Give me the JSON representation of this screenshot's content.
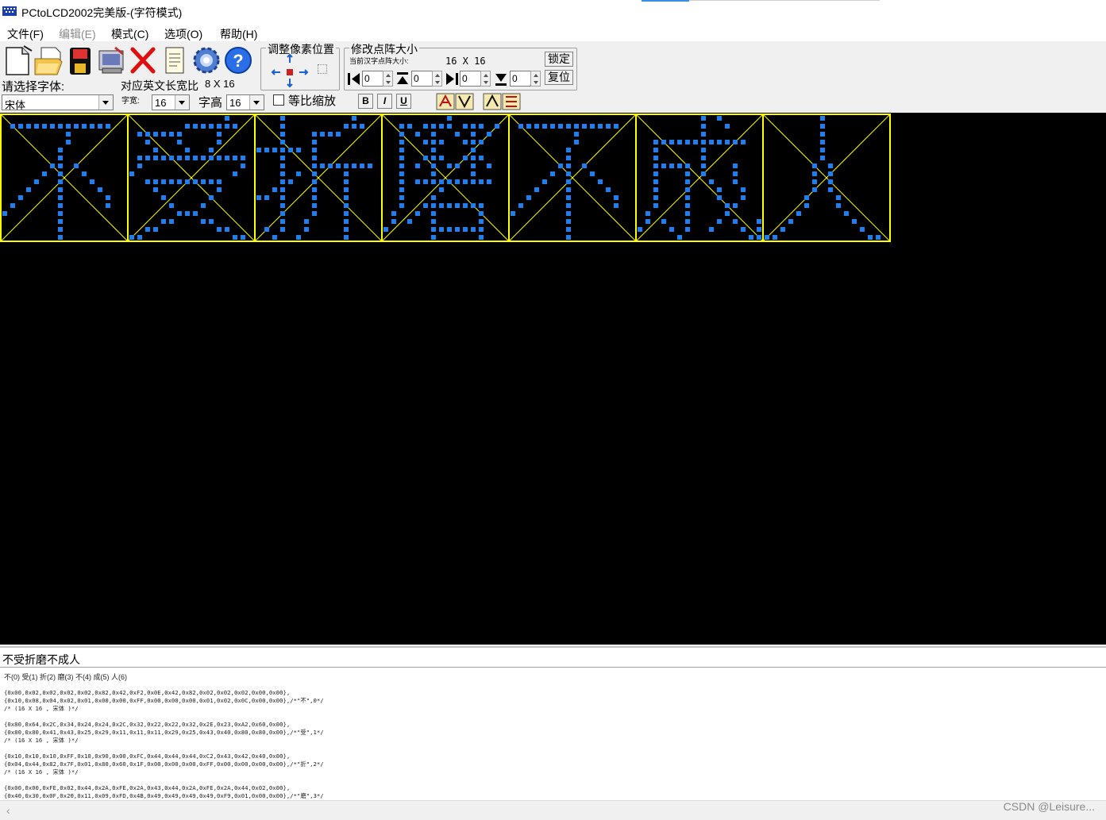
{
  "window": {
    "title": "PCtoLCD2002完美版-(字符模式)"
  },
  "menu": [
    {
      "label": "文件(F)",
      "enabled": true
    },
    {
      "label": "编辑(E)",
      "enabled": false
    },
    {
      "label": "模式(C)",
      "enabled": true
    },
    {
      "label": "选项(O)",
      "enabled": true
    },
    {
      "label": "帮助(H)",
      "enabled": true
    }
  ],
  "toolbar": {
    "icons": [
      "new-file-icon",
      "open-folder-icon",
      "save-disk-icon",
      "generate-icon",
      "delete-icon",
      "notepad-icon",
      "settings-gear-icon",
      "help-icon"
    ]
  },
  "font_settings": {
    "font_label": "请选择字体:",
    "font_value": "宋体",
    "ratio_label": "对应英文长宽比",
    "ratio_value": "8 X 16",
    "width_label": "字宽:",
    "width_value": "16",
    "height_label": "字高",
    "height_value": "16",
    "scale_label": "等比缩放",
    "bold": "B",
    "italic": "I",
    "underline": "U"
  },
  "adjust_group": {
    "title": "调整像素位置"
  },
  "resize_group": {
    "title": "修改点阵大小",
    "current_label": "当前汉字点阵大小:",
    "current_value": "16 X 16",
    "lock_label": "锁定",
    "reset_label": "复位",
    "spin_values": [
      "0",
      "0",
      "0",
      "0"
    ]
  },
  "colors": {
    "pixel": "#1e7ff0",
    "frame": "#ffff00",
    "background": "#000000"
  },
  "characters": [
    "不",
    "受",
    "折",
    "磨",
    "不",
    "成",
    "人"
  ],
  "input_text": "不受折磨不成人",
  "output": {
    "index_line": "不(0) 受(1) 折(2) 磨(3) 不(4) 成(5) 人(6)",
    "lines": [
      "{0x00,0x02,0x02,0x02,0x02,0x82,0x42,0xF2,0x0E,0x42,0x82,0x02,0x02,0x02,0x00,0x00},",
      "{0x10,0x08,0x04,0x02,0x01,0x00,0x00,0xFF,0x00,0x00,0x00,0x01,0x02,0x0C,0x00,0x00},/*\"不\",0*/",
      "/* (16 X 16 , 宋体 )*/",
      "",
      "{0x80,0x64,0x2C,0x34,0x24,0x24,0x2C,0x32,0x22,0x22,0x32,0x2E,0x23,0xA2,0x60,0x00},",
      "{0x80,0x80,0x41,0x43,0x25,0x29,0x11,0x11,0x11,0x29,0x25,0x43,0x40,0x80,0x80,0x00},/*\"受\",1*/",
      "/* (16 X 16 , 宋体 )*/",
      "",
      "{0x10,0x10,0x10,0xFF,0x10,0x90,0x00,0xFC,0x44,0x44,0x44,0xC2,0x43,0x42,0x40,0x00},",
      "{0x04,0x44,0x82,0x7F,0x01,0x80,0x60,0x1F,0x00,0x00,0x00,0xFF,0x00,0x00,0x00,0x00},/*\"折\",2*/",
      "/* (16 X 16 , 宋体 )*/",
      "",
      "{0x00,0x00,0xFE,0x02,0x44,0x2A,0xFE,0x2A,0x43,0x44,0x2A,0xFE,0x2A,0x44,0x02,0x00},",
      "{0x40,0x30,0x0F,0x20,0x11,0x09,0xFD,0x4B,0x49,0x49,0x49,0x49,0xF9,0x01,0x00,0x00},/*\"磨\",3*/"
    ]
  },
  "watermark": "CSDN @Leisure..."
}
